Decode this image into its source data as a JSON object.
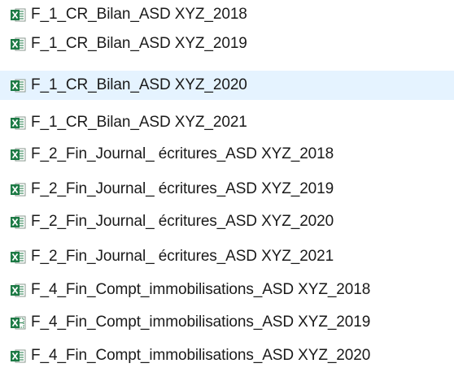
{
  "colors": {
    "selected_row_background": "#e5f3ff",
    "excel_green": "#1d7a45",
    "text": "#1a1a1a"
  },
  "file_list": {
    "selected_index": 2,
    "items": [
      {
        "name": "F_1_CR_Bilan_ASD XYZ_2018",
        "icon": "excel-file-icon"
      },
      {
        "name": "F_1_CR_Bilan_ASD XYZ_2019",
        "icon": "excel-file-icon"
      },
      {
        "name": "F_1_CR_Bilan_ASD XYZ_2020",
        "icon": "excel-file-icon"
      },
      {
        "name": "F_1_CR_Bilan_ASD XYZ_2021",
        "icon": "excel-file-icon"
      },
      {
        "name": "F_2_Fin_Journal_ écritures_ASD XYZ_2018",
        "icon": "excel-file-icon"
      },
      {
        "name": "F_2_Fin_Journal_ écritures_ASD XYZ_2019",
        "icon": "excel-file-icon"
      },
      {
        "name": "F_2_Fin_Journal_ écritures_ASD XYZ_2020",
        "icon": "excel-file-icon"
      },
      {
        "name": "F_2_Fin_Journal_ écritures_ASD XYZ_2021",
        "icon": "excel-file-icon"
      },
      {
        "name": "F_4_Fin_Compt_immobilisations_ASD XYZ_2018",
        "icon": "excel-file-icon"
      },
      {
        "name": "F_4_Fin_Compt_immobilisations_ASD XYZ_2019",
        "icon": "excel-template-file-icon"
      },
      {
        "name": "F_4_Fin_Compt_immobilisations_ASD XYZ_2020",
        "icon": "excel-file-icon"
      }
    ]
  }
}
